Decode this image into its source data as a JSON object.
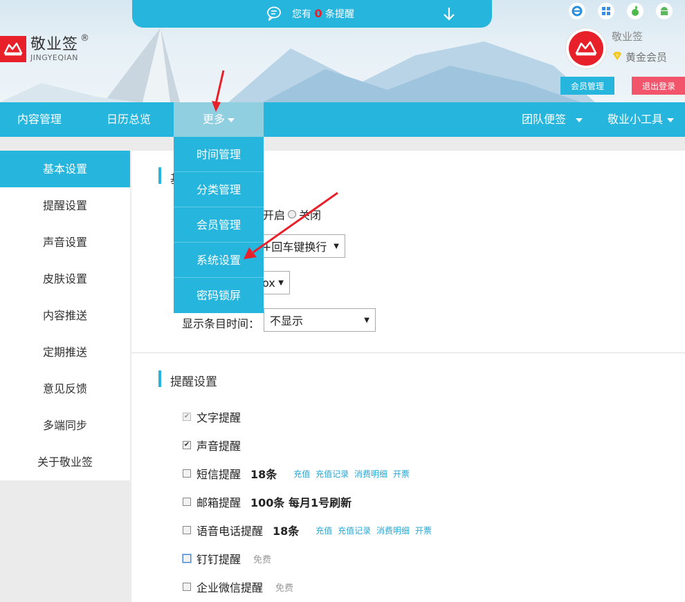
{
  "header": {
    "logo_name": "敬业签",
    "logo_sub": "JINGYEQIAN",
    "logo_reg": "®",
    "notice_prefix": "您有",
    "notice_count": "0",
    "notice_suffix": "条提醒",
    "user_name": "敬业签",
    "vip_level": "黄金会员",
    "member_button": "会员管理",
    "logout_button": "退出登录",
    "os_icons": [
      "ie-icon",
      "windows-icon",
      "apple-icon",
      "android-icon"
    ]
  },
  "nav": {
    "content": "内容管理",
    "calendar": "日历总览",
    "more": "更多",
    "team": "团队便签",
    "tools": "敬业小工具"
  },
  "more_menu": [
    "时间管理",
    "分类管理",
    "会员管理",
    "系统设置",
    "密码锁屏"
  ],
  "sidebar": [
    "基本设置",
    "提醒设置",
    "声音设置",
    "皮肤设置",
    "内容推送",
    "定期推送",
    "意见反馈",
    "多端同步",
    "关于敬业签"
  ],
  "basic": {
    "title_char": "基",
    "radio_on": "开启",
    "radio_off": "关闭",
    "enter_select": "+回车键换行",
    "box_select": "ox",
    "time_label": "显示条目时间：",
    "time_select": "不显示"
  },
  "reminder": {
    "title": "提醒设置",
    "items": [
      {
        "label": "文字提醒",
        "checked": "✔"
      },
      {
        "label": "声音提醒",
        "checked": "✔"
      },
      {
        "label": "短信提醒",
        "count": "18条",
        "links": [
          "充值",
          "充值记录",
          "消费明细",
          "开票"
        ]
      },
      {
        "label": "邮箱提醒",
        "count": "100条 每月1号刷新"
      },
      {
        "label": "语音电话提醒",
        "count": "18条",
        "links": [
          "充值",
          "充值记录",
          "消费明细",
          "开票"
        ]
      },
      {
        "label": "钉钉提醒",
        "note": "免费"
      },
      {
        "label": "企业微信提醒",
        "note": "免费"
      }
    ]
  },
  "colors": {
    "accent": "#25b5dd",
    "brand_red": "#e8202a",
    "logout": "#f2546b"
  }
}
